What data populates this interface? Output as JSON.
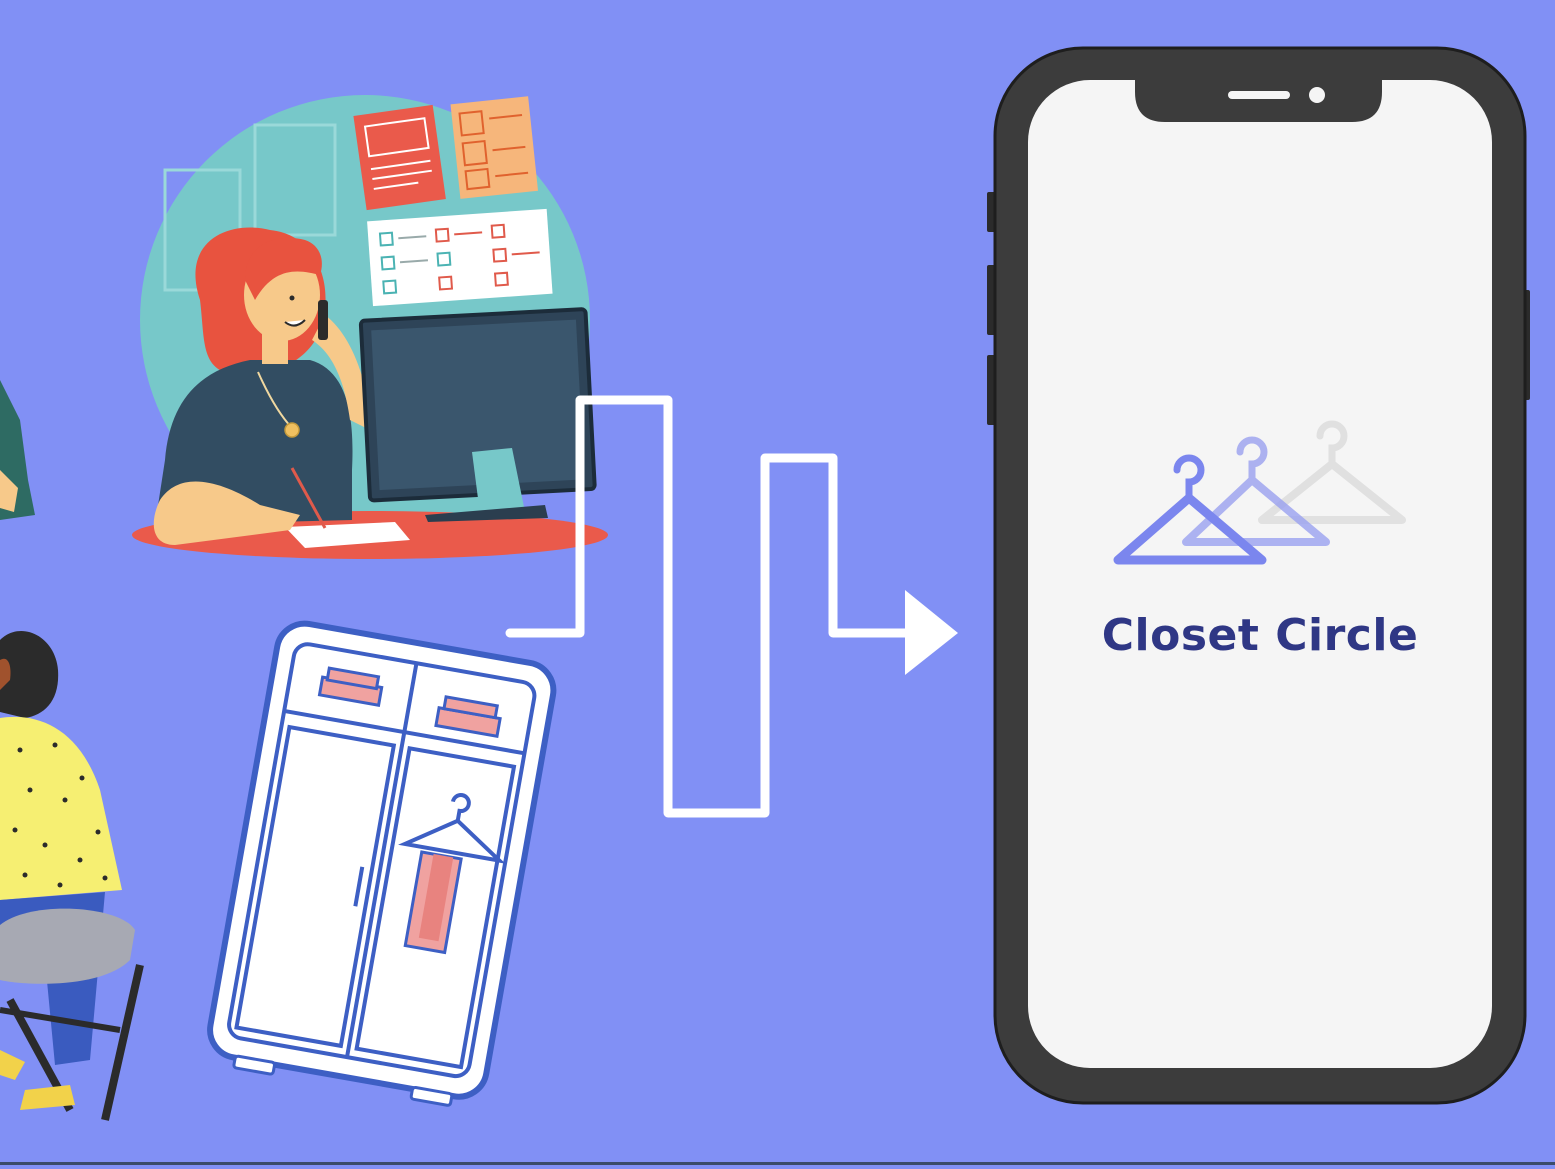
{
  "phone": {
    "app_name": "Closet Circle",
    "logo_icon": "hanger-icon"
  },
  "colors": {
    "background": "#8190f5",
    "phone_frame": "#3c3c3c",
    "screen": "#f5f5f5",
    "brand_text": "#2f3785",
    "hanger_primary": "#7b86ee",
    "hanger_secondary": "#9aa1f0",
    "hanger_tertiary": "#d6d6d6",
    "arrow": "#ffffff"
  },
  "illustrations": [
    {
      "name": "woman-at-desk-illustration"
    },
    {
      "name": "wardrobe-illustration"
    },
    {
      "name": "seated-person-illustration"
    },
    {
      "name": "flow-arrow"
    }
  ]
}
